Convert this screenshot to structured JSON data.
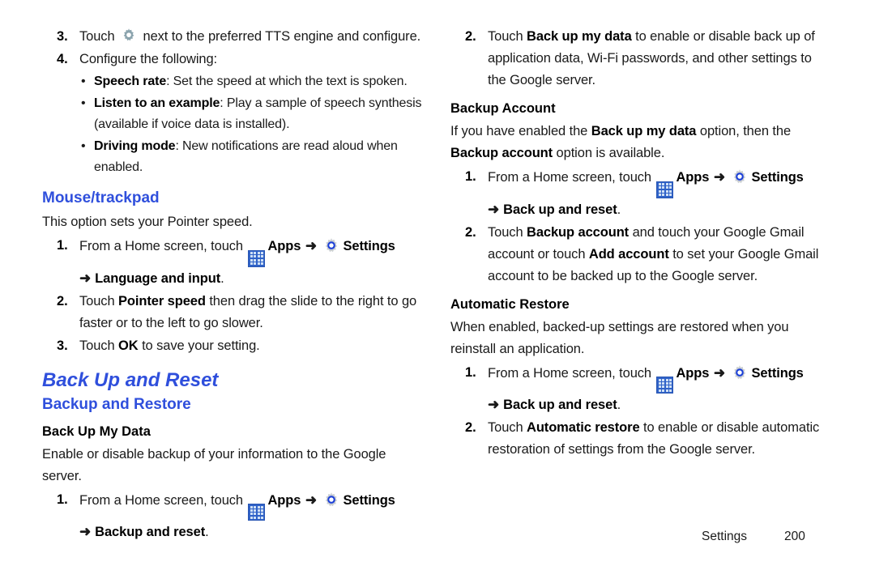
{
  "document": {
    "footer_label": "Settings",
    "footer_page": "200",
    "accent_blue": "#2f4fdc",
    "icon_apps_blue": "#2f62c8",
    "icon_gear_ring_blue": "#1b3fd8",
    "icon_gear_gray": "#c9cdd1",
    "icon_gear_plain": "#8aa3ad"
  },
  "left_column": {
    "step3": {
      "num": "3.",
      "text_before_icon": "Touch",
      "icon": "gear-icon",
      "text_after_icon": "next to the preferred TTS engine and configure."
    },
    "step4": {
      "num": "4.",
      "text": "Configure the following:"
    },
    "bullets": [
      {
        "bold": "Speech rate",
        "rest": ": Set the speed at which the text is spoken."
      },
      {
        "bold": "Listen to an example",
        "rest": ": Play a sample of speech synthesis (available if voice data is installed)."
      },
      {
        "bold": "Driving mode",
        "rest": ": New notifications are read aloud when enabled."
      }
    ],
    "mouse_trackpad": {
      "heading": "Mouse/trackpad",
      "intro": "This option sets your Pointer speed.",
      "step1": {
        "num": "1.",
        "lead": "From a Home screen, touch",
        "apps_label": "Apps",
        "arrow": "➜",
        "settings_label": "Settings",
        "path_arrow": "➜",
        "path_bold": "Language and input",
        "path_period": "."
      },
      "step2": {
        "num": "2.",
        "pre": "Touch",
        "bold": "Pointer speed",
        "post": "then drag the slide to the right to go faster or to the left to go slower."
      },
      "step3": {
        "num": "3.",
        "pre": "Touch",
        "bold": "OK",
        "post": "to save your setting."
      }
    },
    "back_up_and_reset": {
      "heading": "Back Up and Reset",
      "subheading": "Backup and Restore",
      "back_up_my_data": {
        "heading": "Back Up My Data",
        "body": "Enable or disable backup of your information to the Google server.",
        "step1": {
          "num": "1.",
          "lead": "From a Home screen, touch",
          "apps_label": "Apps",
          "arrow": "➜",
          "settings_label": "Settings",
          "path_arrow": "➜",
          "path_bold": "Backup and reset",
          "path_period": "."
        }
      }
    }
  },
  "right_column": {
    "step2": {
      "num": "2.",
      "pre": "Touch",
      "bold": "Back up my data",
      "post": "to enable or disable back up of application data, Wi-Fi passwords, and other settings to the Google server."
    },
    "backup_account": {
      "heading": "Backup Account",
      "body_part1": "If you have enabled the",
      "body_bold1": "Back up my data",
      "body_part2": "option, then the",
      "body_bold2": "Backup account",
      "body_part3": "option is available.",
      "step1": {
        "num": "1.",
        "lead": "From a Home screen, touch",
        "apps_label": "Apps",
        "arrow": "➜",
        "settings_label": "Settings",
        "path_arrow": "➜",
        "path_bold": "Back up and reset",
        "path_period": "."
      },
      "step2": {
        "num": "2.",
        "pre": "Touch",
        "bold1": "Backup account",
        "mid": "and touch your Google Gmail account or touch",
        "bold2": "Add account",
        "post": "to set your Google Gmail account to be backed up to the Google server."
      }
    },
    "automatic_restore": {
      "heading": "Automatic Restore",
      "body": "When enabled, backed-up settings are restored when you reinstall an application.",
      "step1": {
        "num": "1.",
        "lead": "From a Home screen, touch",
        "apps_label": "Apps",
        "arrow": "➜",
        "settings_label": "Settings",
        "path_arrow": "➜",
        "path_bold": "Back up and reset",
        "path_period": "."
      },
      "step2": {
        "num": "2.",
        "pre": "Touch",
        "bold": "Automatic restore",
        "post": "to enable or disable automatic restoration of settings from the Google server."
      }
    }
  }
}
